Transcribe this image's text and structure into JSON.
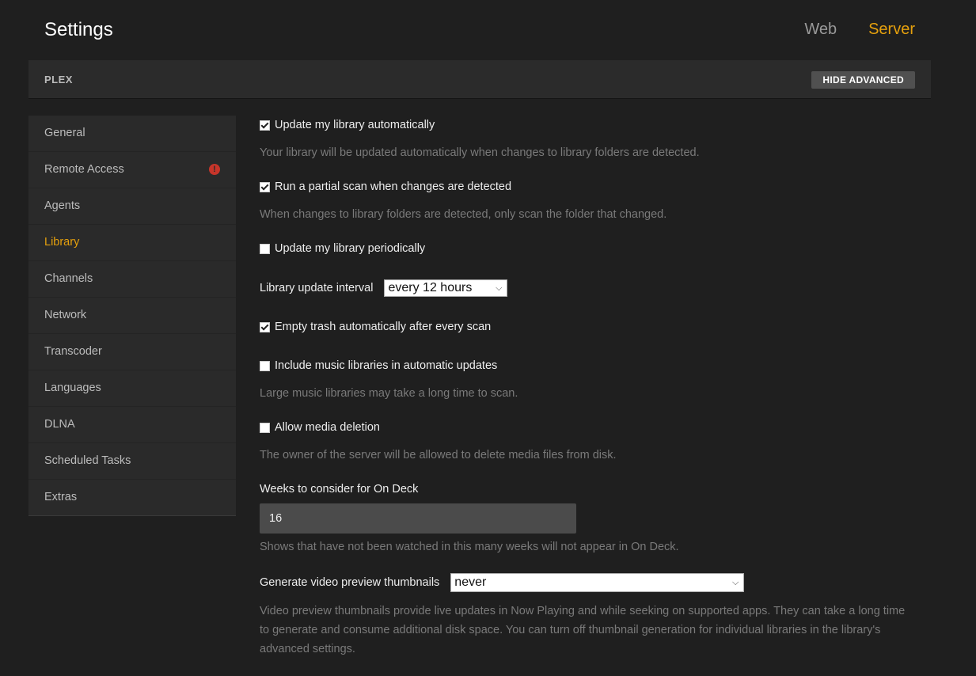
{
  "header": {
    "title": "Settings",
    "tabs": [
      {
        "label": "Web",
        "active": false
      },
      {
        "label": "Server",
        "active": true
      }
    ]
  },
  "server_bar": {
    "name": "PLEX",
    "hide_advanced_label": "HIDE ADVANCED"
  },
  "sidebar": {
    "items": [
      {
        "label": "General"
      },
      {
        "label": "Remote Access",
        "alert": true
      },
      {
        "label": "Agents"
      },
      {
        "label": "Library",
        "active": true
      },
      {
        "label": "Channels"
      },
      {
        "label": "Network"
      },
      {
        "label": "Transcoder"
      },
      {
        "label": "Languages"
      },
      {
        "label": "DLNA"
      },
      {
        "label": "Scheduled Tasks"
      },
      {
        "label": "Extras"
      }
    ]
  },
  "settings": {
    "auto_update": {
      "label": "Update my library automatically",
      "checked": true,
      "help": "Your library will be updated automatically when changes to library folders are detected."
    },
    "partial_scan": {
      "label": "Run a partial scan when changes are detected",
      "checked": true,
      "help": "When changes to library folders are detected, only scan the folder that changed."
    },
    "periodic_update": {
      "label": "Update my library periodically",
      "checked": false
    },
    "update_interval": {
      "label": "Library update interval",
      "value": "every 12 hours"
    },
    "empty_trash": {
      "label": "Empty trash automatically after every scan",
      "checked": true
    },
    "music_updates": {
      "label": "Include music libraries in automatic updates",
      "checked": false,
      "help": "Large music libraries may take a long time to scan."
    },
    "media_deletion": {
      "label": "Allow media deletion",
      "checked": false,
      "help": "The owner of the server will be allowed to delete media files from disk."
    },
    "on_deck_weeks": {
      "label": "Weeks to consider for On Deck",
      "value": "16",
      "help": "Shows that have not been watched in this many weeks will not appear in On Deck."
    },
    "preview_thumbnails": {
      "label": "Generate video preview thumbnails",
      "value": "never",
      "help": "Video preview thumbnails provide live updates in Now Playing and while seeking on supported apps. They can take a long time to generate and consume additional disk space. You can turn off thumbnail generation for individual libraries in the library's advanced settings."
    }
  },
  "colors": {
    "accent": "#e5a00d",
    "background": "#1f1f1f",
    "panel": "#2a2a2a",
    "alert": "#c6352a"
  }
}
